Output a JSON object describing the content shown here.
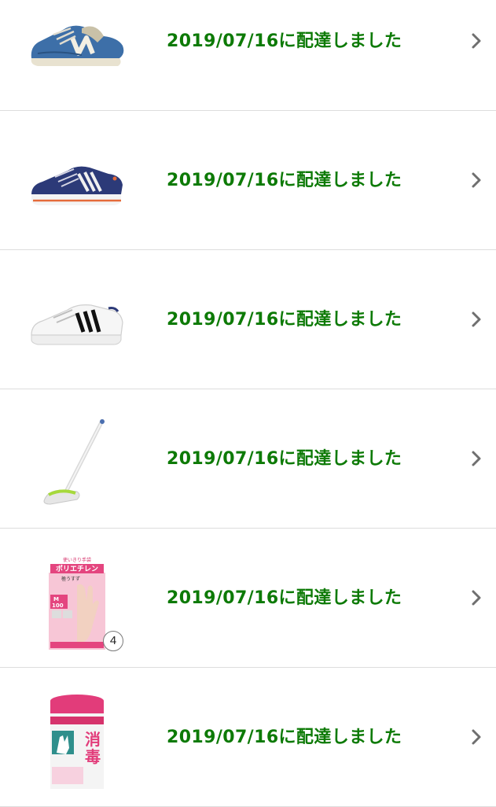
{
  "orders": [
    {
      "status": "2019/07/16に配達しました",
      "image_icon": "blue-sneaker-icon"
    },
    {
      "status": "2019/07/16に配達しました",
      "image_icon": "navy-sneaker-icon"
    },
    {
      "status": "2019/07/16に配達しました",
      "image_icon": "white-sneaker-icon"
    },
    {
      "status": "2019/07/16に配達しました",
      "image_icon": "cleaning-brush-icon"
    },
    {
      "status": "2019/07/16に配達しました",
      "image_icon": "plastic-gloves-box-icon",
      "quantity": "4",
      "product_text": [
        "使いきり手袋",
        "ポリエチレン",
        "極うすず",
        "M",
        "100"
      ]
    },
    {
      "status": "2019/07/16に配達しました",
      "image_icon": "disinfectant-wipes-icon",
      "product_text": [
        "消",
        "毒"
      ]
    }
  ],
  "colors": {
    "status_text": "#0d7a06",
    "divider": "#dddddd",
    "chevron": "#6f6f6f"
  }
}
